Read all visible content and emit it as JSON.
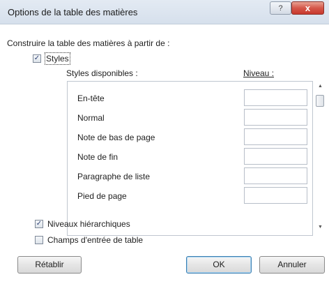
{
  "window": {
    "title": "Options de la table des matières",
    "help_label": "?",
    "close_label": "x"
  },
  "main": {
    "build_label": "Construire la table des matières à partir de :",
    "styles_checkbox": {
      "label": "Styles",
      "checked": true
    },
    "available_styles_header": "Styles disponibles :",
    "level_header": "Niveau :",
    "styles": [
      {
        "name": "En-tête",
        "level": ""
      },
      {
        "name": "Normal",
        "level": ""
      },
      {
        "name": "Note de bas de page",
        "level": ""
      },
      {
        "name": "Note de fin",
        "level": ""
      },
      {
        "name": "Paragraphe de liste",
        "level": ""
      },
      {
        "name": "Pied de page",
        "level": ""
      }
    ],
    "outline_levels_checkbox": {
      "label": "Niveaux hiérarchiques",
      "checked": true
    },
    "table_entry_fields_checkbox": {
      "label": "Champs d'entrée de table",
      "checked": false
    }
  },
  "buttons": {
    "reset": "Rétablir",
    "ok": "OK",
    "cancel": "Annuler"
  }
}
